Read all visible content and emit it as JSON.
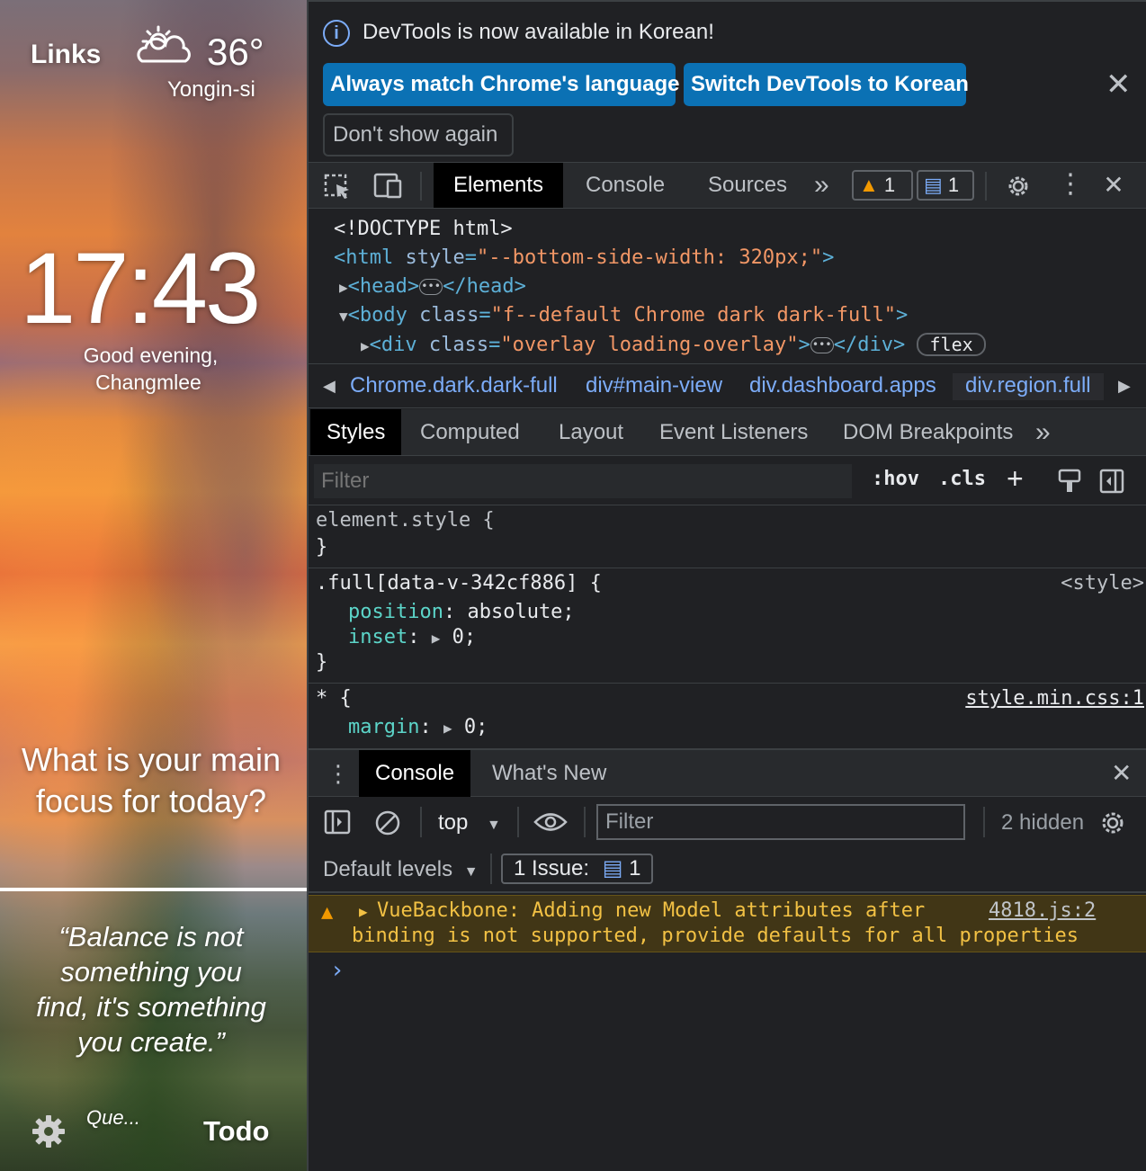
{
  "newtab": {
    "links_label": "Links",
    "weather_icon": "partly-cloudy-icon",
    "temperature": "36°",
    "location": "Yongin-si",
    "clock": "17:43",
    "greeting_line1": "Good evening,",
    "greeting_line2": "Changmlee",
    "focus_line1": "What is your main",
    "focus_line2": "focus for today?",
    "quote_lines": [
      "“Balance is not",
      "something you",
      "find, it's something",
      "you create.”"
    ],
    "quote_author": "Que...",
    "todo_label": "Todo"
  },
  "devtools": {
    "infobar": {
      "message": "DevTools is now available in Korean!",
      "always_match": "Always match Chrome's language",
      "switch_korean": "Switch DevTools to Korean",
      "dont_show": "Don't show again",
      "close": "✕"
    },
    "main_tabs": {
      "elements": "Elements",
      "console": "Console",
      "sources": "Sources",
      "more": "»",
      "warnings_count": "1",
      "messages_count": "1"
    },
    "dom": {
      "doctype": "<!DOCTYPE html>",
      "html_open": "<html",
      "html_attr": "style",
      "html_val": "\"--bottom-side-width: 320px;\"",
      "head_open": "<head>",
      "head_close": "</head>",
      "body_open": "<body",
      "body_attr": "class",
      "body_val": "\"f--default Chrome dark dark-full\"",
      "div_open": "<div",
      "div_attr": "class",
      "div_val": "\"overlay loading-overlay\"",
      "div_close": "</div>",
      "flex_badge": "flex"
    },
    "breadcrumbs": [
      "Chrome.dark.dark-full",
      "div#main-view",
      "div.dashboard.apps",
      "div.region.full"
    ],
    "sub_tabs": {
      "styles": "Styles",
      "computed": "Computed",
      "layout": "Layout",
      "event_listeners": "Event Listeners",
      "dom_breakpoints": "DOM Breakpoints",
      "more": "»"
    },
    "styles_filter": {
      "placeholder": "Filter",
      "hov": ":hov",
      "cls": ".cls"
    },
    "styles_rules": {
      "element_style": "element.style {",
      "close_brace": "}",
      "full_selector": ".full[data-v-342cf886] {",
      "full_source": "<style>",
      "position_prop": "position",
      "position_val": "absolute;",
      "inset_prop": "inset",
      "inset_val": "0;",
      "star_selector": "* {",
      "star_source": "style.min.css:1",
      "margin_prop": "margin",
      "margin_val": "0;"
    },
    "drawer": {
      "console_tab": "Console",
      "whats_new_tab": "What's New",
      "context": "top",
      "filter_placeholder": "Filter",
      "hidden_count": "2 hidden",
      "default_levels": "Default levels",
      "issues_label": "1 Issue:",
      "issues_count": "1"
    },
    "warning": {
      "line1": "VueBackbone: Adding new Model attributes after",
      "line2": "binding is not supported, provide defaults for all properties",
      "source": "4818.js:2"
    },
    "prompt": "›"
  },
  "colors": {
    "accent_blue": "#0b71b4",
    "link_blue": "#7cacf8",
    "warning_bg": "#413616",
    "warning_text": "#f2c144"
  }
}
